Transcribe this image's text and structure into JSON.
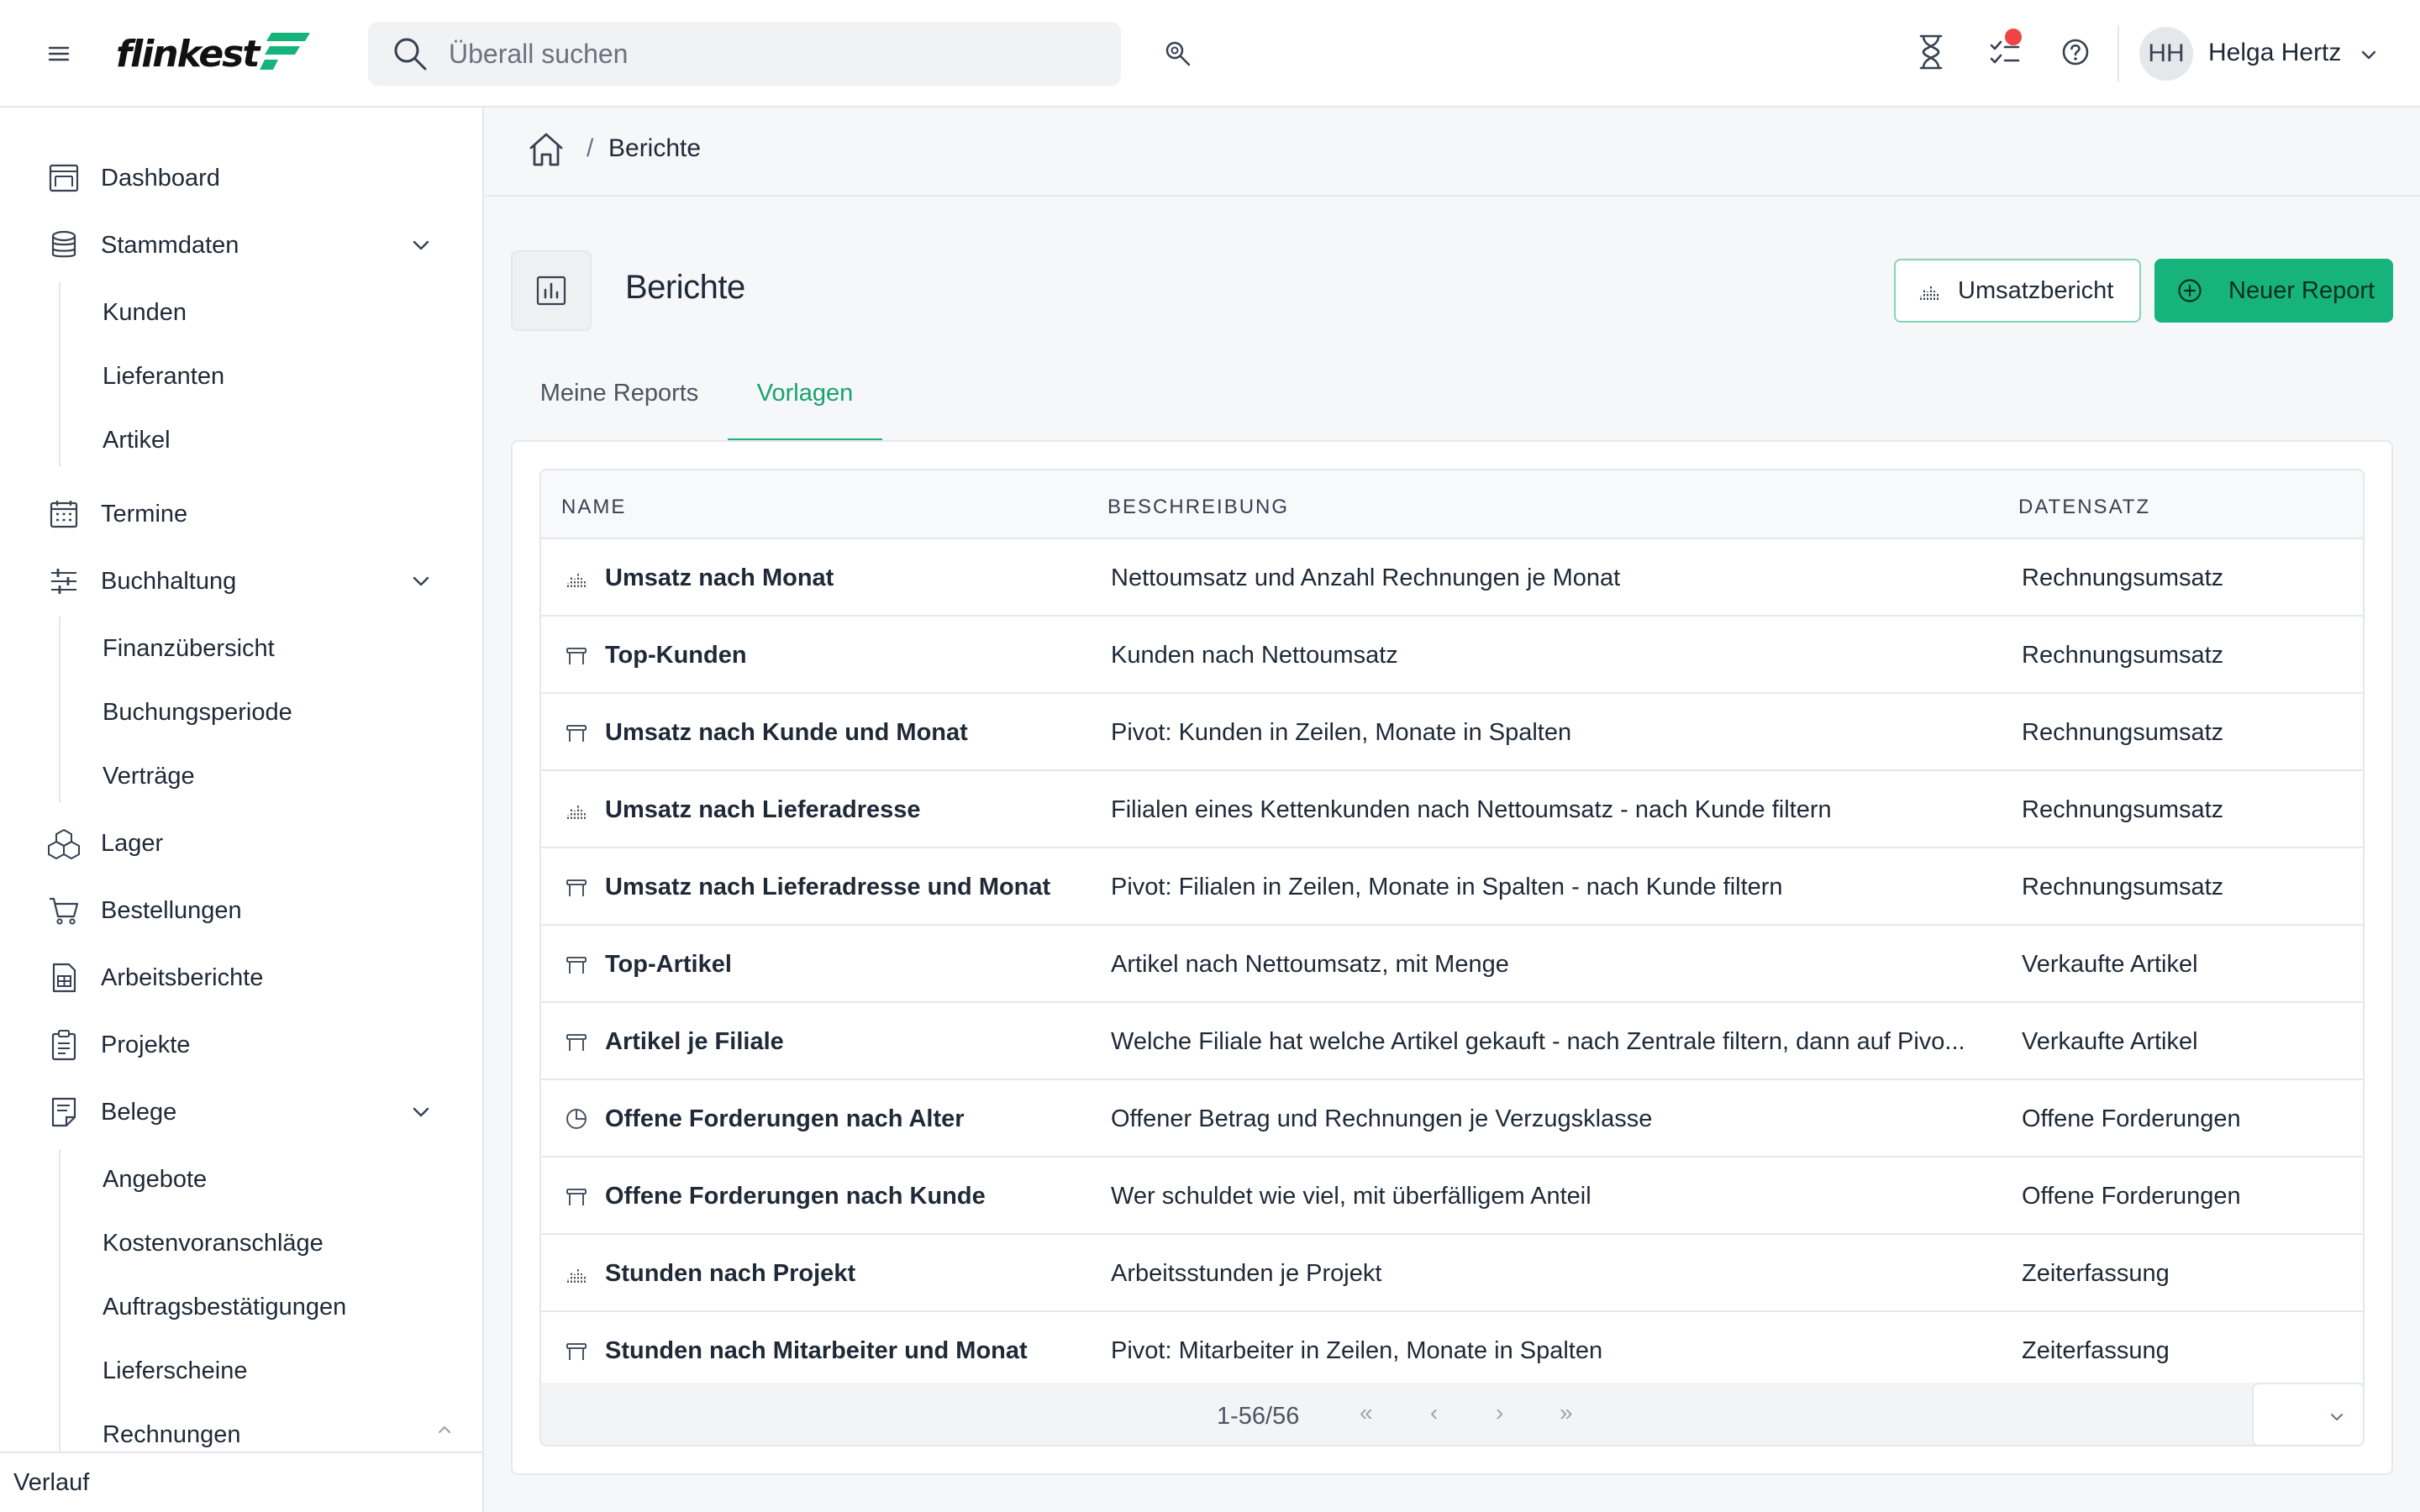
{
  "app": {
    "logo_text": "flinkest",
    "search_placeholder": "Überall suchen",
    "user": {
      "initials": "HH",
      "name": "Helga Hertz"
    },
    "colors": {
      "accent": "#16b47c",
      "notification": "#ef4444"
    }
  },
  "sidebar": {
    "items": [
      {
        "label": "Dashboard",
        "icon": "dashboard-icon"
      },
      {
        "label": "Stammdaten",
        "icon": "database-icon",
        "expanded": true,
        "children": [
          "Kunden",
          "Lieferanten",
          "Artikel"
        ]
      },
      {
        "label": "Termine",
        "icon": "calendar-icon"
      },
      {
        "label": "Buchhaltung",
        "icon": "sliders-icon",
        "expanded": true,
        "children": [
          "Finanzübersicht",
          "Buchungsperiode",
          "Verträge"
        ]
      },
      {
        "label": "Lager",
        "icon": "boxes-icon"
      },
      {
        "label": "Bestellungen",
        "icon": "cart-icon"
      },
      {
        "label": "Arbeitsberichte",
        "icon": "report-sheet-icon"
      },
      {
        "label": "Projekte",
        "icon": "clipboard-icon"
      },
      {
        "label": "Belege",
        "icon": "document-icon",
        "expanded": true,
        "children": [
          "Angebote",
          "Kostenvoranschläge",
          "Auftragsbestätigungen",
          "Lieferscheine",
          "Rechnungen"
        ]
      }
    ],
    "footer": "Verlauf"
  },
  "breadcrumb": {
    "current": "Berichte",
    "separator": "/"
  },
  "page": {
    "title": "Berichte",
    "buttons": {
      "secondary": "Umsatzbericht",
      "primary": "Neuer Report"
    },
    "tabs": [
      {
        "label": "Meine Reports",
        "active": false
      },
      {
        "label": "Vorlagen",
        "active": true
      }
    ]
  },
  "table": {
    "columns": {
      "name": "NAME",
      "description": "BESCHREIBUNG",
      "dataset": "DATENSATZ"
    },
    "rows": [
      {
        "icon": "bar-chart-icon",
        "name": "Umsatz nach Monat",
        "description": "Nettoumsatz und Anzahl Rechnungen je Monat",
        "dataset": "Rechnungsumsatz"
      },
      {
        "icon": "table-icon",
        "name": "Top-Kunden",
        "description": "Kunden nach Nettoumsatz",
        "dataset": "Rechnungsumsatz"
      },
      {
        "icon": "table-icon",
        "name": "Umsatz nach Kunde und Monat",
        "description": "Pivot: Kunden in Zeilen, Monate in Spalten",
        "dataset": "Rechnungsumsatz"
      },
      {
        "icon": "bar-chart-icon",
        "name": "Umsatz nach Lieferadresse",
        "description": "Filialen eines Kettenkunden nach Nettoumsatz - nach Kunde filtern",
        "dataset": "Rechnungsumsatz"
      },
      {
        "icon": "table-icon",
        "name": "Umsatz nach Lieferadresse und Monat",
        "description": "Pivot: Filialen in Zeilen, Monate in Spalten - nach Kunde filtern",
        "dataset": "Rechnungsumsatz"
      },
      {
        "icon": "table-icon",
        "name": "Top-Artikel",
        "description": "Artikel nach Nettoumsatz, mit Menge",
        "dataset": "Verkaufte Artikel"
      },
      {
        "icon": "table-icon",
        "name": "Artikel je Filiale",
        "description": "Welche Filiale hat welche Artikel gekauft - nach Zentrale filtern, dann auf Pivo...",
        "dataset": "Verkaufte Artikel"
      },
      {
        "icon": "pie-chart-icon",
        "name": "Offene Forderungen nach Alter",
        "description": "Offener Betrag und Rechnungen je Verzugsklasse",
        "dataset": "Offene Forderungen"
      },
      {
        "icon": "table-icon",
        "name": "Offene Forderungen nach Kunde",
        "description": "Wer schuldet wie viel, mit überfälligem Anteil",
        "dataset": "Offene Forderungen"
      },
      {
        "icon": "bar-chart-icon",
        "name": "Stunden nach Projekt",
        "description": "Arbeitsstunden je Projekt",
        "dataset": "Zeiterfassung"
      },
      {
        "icon": "table-icon",
        "name": "Stunden nach Mitarbeiter und Monat",
        "description": "Pivot: Mitarbeiter in Zeilen, Monate in Spalten",
        "dataset": "Zeiterfassung"
      }
    ],
    "pagination": {
      "range": "1-56/56",
      "first": "«",
      "prev": "‹",
      "next": "›",
      "last": "»"
    }
  }
}
